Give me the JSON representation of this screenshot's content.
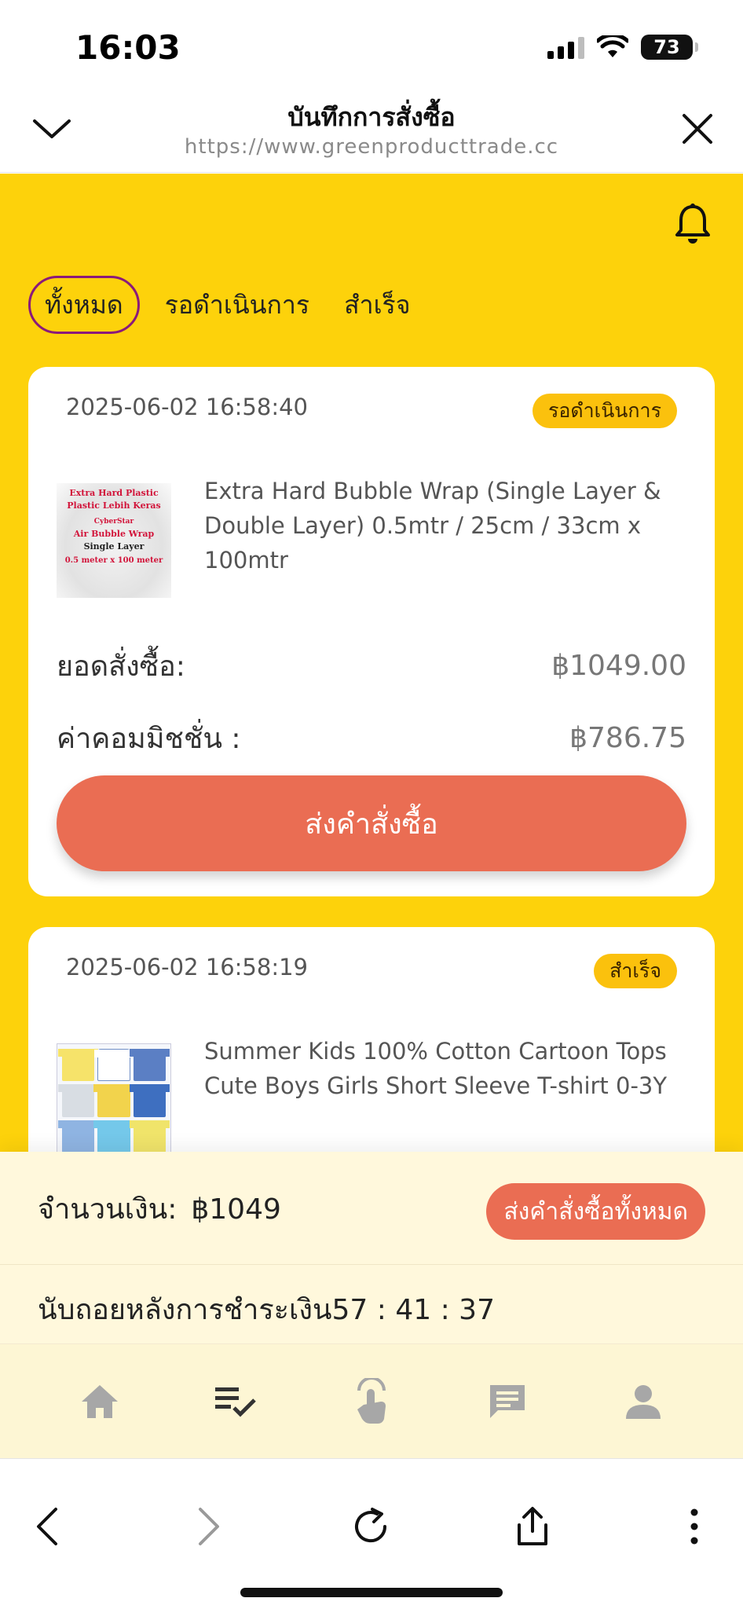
{
  "status_bar": {
    "time": "16:03",
    "battery": "73"
  },
  "browser": {
    "title": "บันทึกการสั่งซื้อ",
    "url": "https://www.greenproducttrade.cc"
  },
  "tabs": [
    {
      "label": "ทั้งหมด",
      "active": true
    },
    {
      "label": "รอดำเนินการ",
      "active": false
    },
    {
      "label": "สำเร็จ",
      "active": false
    }
  ],
  "orders": [
    {
      "time": "2025-06-02 16:58:40",
      "status": "รอดำเนินการ",
      "product_name": "Extra Hard Bubble Wrap (Single Layer & Double Layer) 0.5mtr / 25cm / 33cm x 100mtr",
      "thumb_text": [
        "Extra Hard Plastic",
        "Plastic Lebih Keras",
        "CyberStar",
        "Air Bubble Wrap",
        "Single Layer",
        "0.5 meter x 100 meter"
      ],
      "amount_label": "ยอดสั่งซื้อ:",
      "amount": "฿1049.00",
      "commission_label": "ค่าคอมมิชชั่น :",
      "commission": "฿786.75",
      "submit_label": "ส่งคำสั่งซื้อ"
    },
    {
      "time": "2025-06-02 16:58:19",
      "status": "สำเร็จ",
      "product_name": "Summer Kids 100% Cotton Cartoon Tops Cute Boys Girls Short Sleeve T-shirt 0-3Y"
    }
  ],
  "summary": {
    "amount_label": "จำนวนเงิน:",
    "amount_value": "฿1049",
    "submit_all_label": "ส่งคำสั่งซื้อทั้งหมด",
    "countdown_label": "นับถอยหลังการชำระเงิน",
    "countdown_value": "57 : 41 : 37"
  },
  "bottom_nav": [
    {
      "icon": "home-icon"
    },
    {
      "icon": "order-list-icon"
    },
    {
      "icon": "tap-hand-icon"
    },
    {
      "icon": "chat-icon"
    },
    {
      "icon": "profile-icon"
    }
  ],
  "colors": {
    "primary_yellow": "#fdd20b",
    "accent_orange": "#ea6d53",
    "badge_yellow": "#fbc10d",
    "active_tab_border": "#8b1a7a"
  }
}
